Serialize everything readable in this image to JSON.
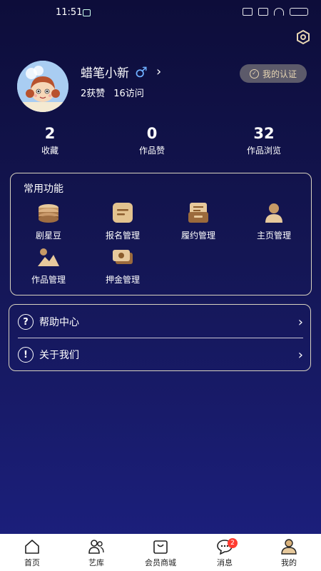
{
  "status_bar": {
    "time": "11:51"
  },
  "profile": {
    "nickname": "蜡笔小新",
    "gender_symbol": "♂",
    "likes": "2获赞",
    "visits": "16访问",
    "certification_label": "我的认证"
  },
  "metrics": [
    {
      "value": "2",
      "label": "收藏"
    },
    {
      "value": "0",
      "label": "作品赞"
    },
    {
      "value": "32",
      "label": "作品浏览"
    }
  ],
  "functions": {
    "title": "常用功能",
    "items": [
      {
        "label": "剧星豆",
        "icon": "coins-icon"
      },
      {
        "label": "报名管理",
        "icon": "form-icon"
      },
      {
        "label": "履约管理",
        "icon": "contract-icon"
      },
      {
        "label": "主页管理",
        "icon": "profile-icon"
      },
      {
        "label": "作品管理",
        "icon": "picture-icon"
      },
      {
        "label": "押金管理",
        "icon": "money-icon"
      }
    ]
  },
  "menu": [
    {
      "label": "帮助中心",
      "icon_glyph": "?"
    },
    {
      "label": "关于我们",
      "icon_glyph": "!"
    }
  ],
  "tabs": [
    {
      "label": "首页"
    },
    {
      "label": "艺库"
    },
    {
      "label": "会员商城"
    },
    {
      "label": "消息",
      "badge": "2"
    },
    {
      "label": "我的"
    }
  ],
  "colors": {
    "background_top": "#0d0d3a",
    "background_bottom": "#1c2080",
    "gold": "#e8d6b3",
    "gender_blue": "#6fb0ff",
    "badge_red": "#ff3b30"
  }
}
